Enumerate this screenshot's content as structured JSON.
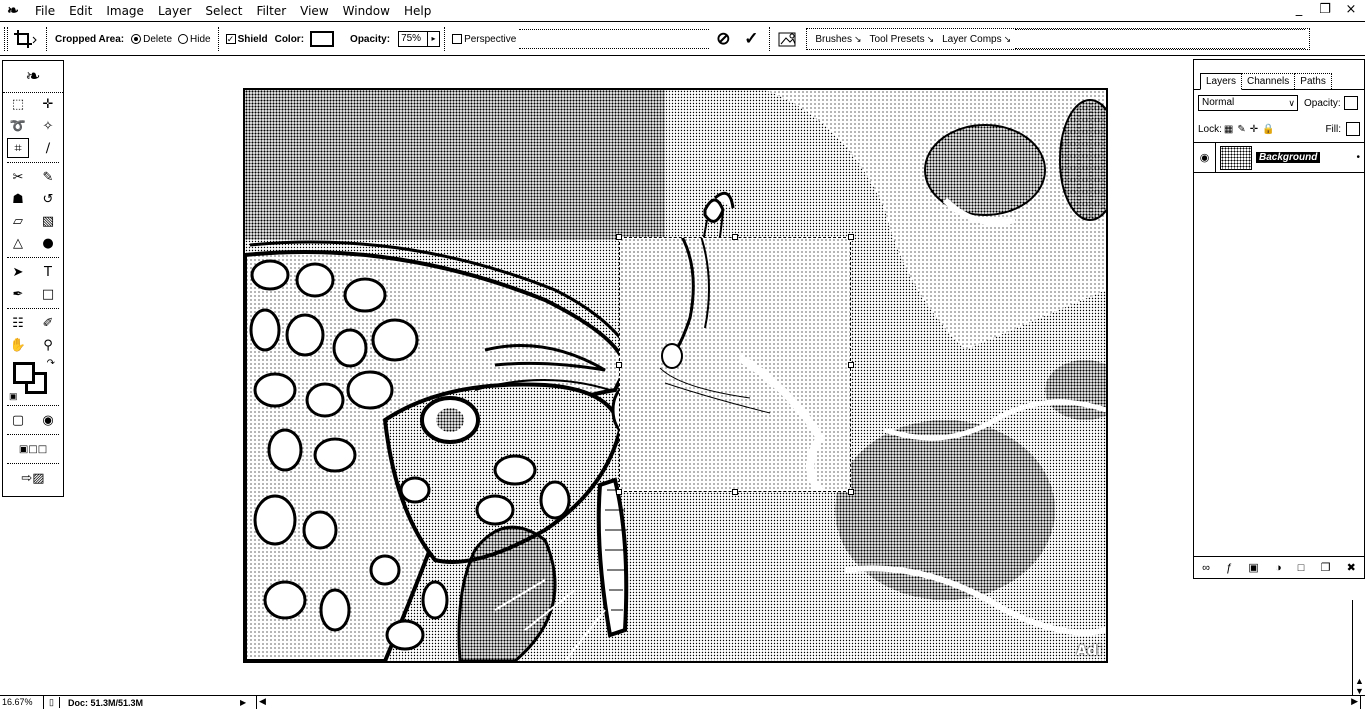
{
  "menubar": {
    "app_icon": "photoshop-feather-icon",
    "items": [
      "File",
      "Edit",
      "Image",
      "Layer",
      "Select",
      "Filter",
      "View",
      "Window",
      "Help"
    ],
    "window_controls": [
      "_",
      "❐",
      "×"
    ]
  },
  "options": {
    "cropped_area_label": "Cropped Area:",
    "delete_label": "Delete",
    "hide_label": "Hide",
    "shield_label": "Shield",
    "color_label": "Color:",
    "opacity_label": "Opacity:",
    "opacity_value": "75%",
    "perspective_label": "Perspective",
    "cancel_glyph": "⊘",
    "commit_glyph": "✓",
    "wells": [
      "Brushes",
      "Tool Presets",
      "Layer Comps"
    ]
  },
  "document": {
    "watermark": "Adi"
  },
  "layers_panel": {
    "tabs": [
      "Layers",
      "Channels",
      "Paths"
    ],
    "blend_mode": "Normal",
    "opacity_label": "Opacity:",
    "lock_label": "Lock:",
    "fill_label": "Fill:",
    "layer_name": "Background"
  },
  "status": {
    "zoom": "16.67%",
    "doc_size": "Doc: 51.3M/51.3M"
  }
}
